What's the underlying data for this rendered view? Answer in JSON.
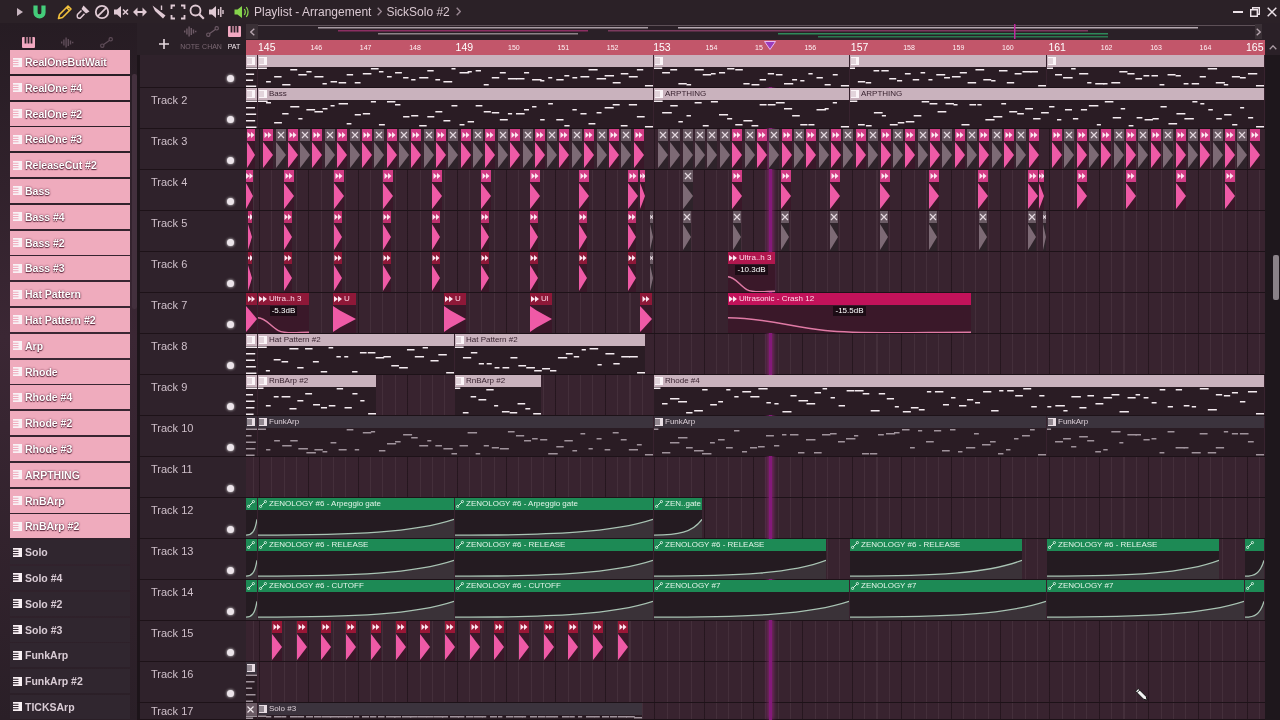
{
  "toolbar": {
    "snap": {
      "on": true
    },
    "tools": [
      {
        "kind": "draw",
        "selected": true
      },
      {
        "kind": "paint",
        "selected": false
      },
      {
        "kind": "delete",
        "selected": false
      },
      {
        "kind": "mute",
        "selected": false
      },
      {
        "kind": "slip",
        "selected": false
      },
      {
        "kind": "slice",
        "selected": false
      },
      {
        "kind": "select",
        "selected": false
      },
      {
        "kind": "zoom",
        "selected": false
      },
      {
        "kind": "playback",
        "selected": false
      }
    ],
    "breadcrumb": [
      "Playlist - Arrangement",
      "SickSolo #2"
    ]
  },
  "picker": {
    "tabs": [
      {
        "kind": "patterns",
        "selected": true
      },
      {
        "kind": "audio",
        "selected": false
      },
      {
        "kind": "automation",
        "selected": false
      }
    ],
    "items": [
      {
        "label": "RealOneButWait",
        "color": "#efabbd"
      },
      {
        "label": "RealOne #4",
        "color": "#efabbd"
      },
      {
        "label": "RealOne #2",
        "color": "#efabbd"
      },
      {
        "label": "RealOne #3",
        "color": "#efabbd"
      },
      {
        "label": "ReleaseCut #2",
        "color": "#efabbd"
      },
      {
        "label": "Bass",
        "color": "#efabbd"
      },
      {
        "label": "Bass #4",
        "color": "#efabbd"
      },
      {
        "label": "Bass #2",
        "color": "#efabbd"
      },
      {
        "label": "Bass #3",
        "color": "#efabbd"
      },
      {
        "label": "Hat Pattern",
        "color": "#efabbd"
      },
      {
        "label": "Hat Pattern #2",
        "color": "#efabbd"
      },
      {
        "label": "Arp",
        "color": "#efabbd"
      },
      {
        "label": "Rhode",
        "color": "#efabbd"
      },
      {
        "label": "Rhode #4",
        "color": "#efabbd"
      },
      {
        "label": "Rhode #2",
        "color": "#efabbd"
      },
      {
        "label": "Rhode #3",
        "color": "#efabbd"
      },
      {
        "label": "ARPTHING",
        "color": "#efabbd"
      },
      {
        "label": "RnBArp",
        "color": "#efabbd"
      },
      {
        "label": "RnBArp #2",
        "color": "#efabbd"
      },
      {
        "label": "Solo",
        "color": "#30262f"
      },
      {
        "label": "Solo #4",
        "color": "#30262f"
      },
      {
        "label": "Solo #2",
        "color": "#30262f"
      },
      {
        "label": "Solo #3",
        "color": "#30262f"
      },
      {
        "label": "FunkArp",
        "color": "#30262f"
      },
      {
        "label": "FunkArp #2",
        "color": "#30262f"
      },
      {
        "label": "TICKSArp",
        "color": "#30262f"
      }
    ]
  },
  "modes": [
    {
      "label": "NOTE",
      "kind": "note",
      "selected": false
    },
    {
      "label": "CHAN",
      "kind": "channel",
      "selected": false
    },
    {
      "label": "PAT",
      "kind": "pattern",
      "selected": true
    }
  ],
  "ruler": [
    {
      "label": "145",
      "major": true
    },
    {
      "label": "146",
      "major": false
    },
    {
      "label": "147",
      "major": false
    },
    {
      "label": "148",
      "major": false
    },
    {
      "label": "149",
      "major": true
    },
    {
      "label": "150",
      "major": false
    },
    {
      "label": "151",
      "major": false
    },
    {
      "label": "152",
      "major": false
    },
    {
      "label": "153",
      "major": true
    },
    {
      "label": "154",
      "major": false
    },
    {
      "label": "15",
      "major": false
    },
    {
      "label": "156",
      "major": false
    },
    {
      "label": "157",
      "major": true
    },
    {
      "label": "158",
      "major": false
    },
    {
      "label": "159",
      "major": false
    },
    {
      "label": "160",
      "major": false
    },
    {
      "label": "161",
      "major": true
    },
    {
      "label": "162",
      "major": false
    },
    {
      "label": "163",
      "major": false
    },
    {
      "label": "164",
      "major": false
    },
    {
      "label": "165",
      "major": true
    }
  ],
  "tracks": [
    {
      "enabled": true,
      "color": "#c9b2bd",
      "clips": [
        {
          "kind": "pattern"
        },
        {
          "kind": "pattern"
        },
        {
          "kind": "pattern"
        },
        {
          "kind": "pattern"
        },
        {
          "kind": "pattern"
        }
      ]
    },
    {
      "label": "Track 2",
      "enabled": true,
      "color": "#c9b2bd",
      "clips": [
        {
          "kind": "pattern"
        },
        {
          "kind": "pattern",
          "label": "Bass"
        },
        {
          "kind": "pattern",
          "label": "ARPTHING"
        },
        {
          "kind": "pattern",
          "label": "ARPTHING"
        }
      ]
    },
    {
      "label": "Track 3",
      "enabled": true,
      "color": "#d23c86",
      "clips": [
        {
          "kind": "audio",
          "muted": false
        },
        {
          "kind": "audio",
          "muted": false
        },
        {
          "kind": "audio",
          "muted": true
        },
        {
          "kind": "audio",
          "muted": false
        },
        {
          "kind": "audio",
          "muted": true
        },
        {
          "kind": "audio",
          "muted": false
        },
        {
          "kind": "audio",
          "muted": true
        },
        {
          "kind": "audio",
          "muted": false
        },
        {
          "kind": "audio",
          "muted": true
        },
        {
          "kind": "audio",
          "muted": false
        },
        {
          "kind": "audio",
          "muted": true
        },
        {
          "kind": "audio",
          "muted": false
        },
        {
          "kind": "audio",
          "muted": true
        },
        {
          "kind": "audio",
          "muted": false
        },
        {
          "kind": "audio",
          "muted": true
        },
        {
          "kind": "audio",
          "muted": false
        },
        {
          "kind": "audio",
          "muted": true
        },
        {
          "kind": "audio",
          "muted": false
        },
        {
          "kind": "audio",
          "muted": true
        },
        {
          "kind": "audio",
          "muted": false
        },
        {
          "kind": "audio",
          "muted": true
        },
        {
          "kind": "audio",
          "muted": false
        },
        {
          "kind": "audio",
          "muted": true
        },
        {
          "kind": "audio",
          "muted": false
        },
        {
          "kind": "audio",
          "muted": true
        },
        {
          "kind": "audio",
          "muted": false
        },
        {
          "kind": "audio",
          "muted": true
        },
        {
          "kind": "audio",
          "muted": false
        },
        {
          "kind": "audio",
          "muted": true
        },
        {
          "kind": "audio",
          "muted": false
        },
        {
          "kind": "audio",
          "muted": true
        },
        {
          "kind": "audio",
          "muted": false
        },
        {
          "kind": "audio",
          "muted": true
        },
        {
          "kind": "audio",
          "muted": true
        },
        {
          "kind": "audio",
          "muted": true
        },
        {
          "kind": "audio",
          "muted": true
        },
        {
          "kind": "audio",
          "muted": true
        },
        {
          "kind": "audio",
          "muted": true
        },
        {
          "kind": "audio",
          "muted": false
        },
        {
          "kind": "audio",
          "muted": true
        },
        {
          "kind": "audio",
          "muted": false
        },
        {
          "kind": "audio",
          "muted": true
        },
        {
          "kind": "audio",
          "muted": false
        },
        {
          "kind": "audio",
          "muted": true
        },
        {
          "kind": "audio",
          "muted": false
        },
        {
          "kind": "audio",
          "muted": true
        },
        {
          "kind": "audio",
          "muted": false
        },
        {
          "kind": "audio",
          "muted": true
        },
        {
          "kind": "audio",
          "muted": false
        },
        {
          "kind": "audio",
          "muted": true
        },
        {
          "kind": "audio",
          "muted": false
        },
        {
          "kind": "audio",
          "muted": true
        },
        {
          "kind": "audio",
          "muted": false
        },
        {
          "kind": "audio",
          "muted": true
        },
        {
          "kind": "audio",
          "muted": false
        },
        {
          "kind": "audio",
          "muted": true
        },
        {
          "kind": "audio",
          "muted": false
        },
        {
          "kind": "audio",
          "muted": true
        },
        {
          "kind": "audio",
          "muted": false
        },
        {
          "kind": "audio",
          "muted": true
        },
        {
          "kind": "audio",
          "muted": false
        },
        {
          "kind": "audio",
          "muted": true
        },
        {
          "kind": "audio",
          "muted": false
        },
        {
          "kind": "audio",
          "muted": false
        },
        {
          "kind": "audio",
          "muted": true
        },
        {
          "kind": "audio",
          "muted": false
        },
        {
          "kind": "audio",
          "muted": true
        },
        {
          "kind": "audio",
          "muted": false
        },
        {
          "kind": "audio",
          "muted": true
        },
        {
          "kind": "audio",
          "muted": false
        },
        {
          "kind": "audio",
          "muted": true
        },
        {
          "kind": "audio",
          "muted": false
        },
        {
          "kind": "audio",
          "muted": true
        },
        {
          "kind": "audio",
          "muted": false
        },
        {
          "kind": "audio",
          "muted": true
        },
        {
          "kind": "audio",
          "muted": false
        },
        {
          "kind": "audio",
          "muted": true
        },
        {
          "kind": "audio",
          "muted": false
        },
        {
          "kind": "audio",
          "muted": true
        },
        {
          "kind": "audio",
          "muted": false
        }
      ]
    },
    {
      "label": "Track 4",
      "enabled": true,
      "color": "#d23c86",
      "clips": [
        {
          "kind": "audio",
          "muted": false
        },
        {
          "kind": "audio",
          "muted": false
        },
        {
          "kind": "audio",
          "muted": false
        },
        {
          "kind": "audio",
          "muted": false
        },
        {
          "kind": "audio",
          "muted": false
        },
        {
          "kind": "audio",
          "muted": false
        },
        {
          "kind": "audio",
          "muted": false
        },
        {
          "kind": "audio",
          "muted": false
        },
        {
          "kind": "audio",
          "muted": false
        },
        {
          "kind": "audio",
          "muted": false
        },
        {
          "kind": "audio",
          "muted": true
        },
        {
          "kind": "audio",
          "muted": false
        },
        {
          "kind": "audio",
          "muted": false
        },
        {
          "kind": "audio",
          "muted": false
        },
        {
          "kind": "audio",
          "muted": false
        },
        {
          "kind": "audio",
          "muted": false
        },
        {
          "kind": "audio",
          "muted": false
        },
        {
          "kind": "audio",
          "muted": false
        },
        {
          "kind": "audio",
          "muted": false
        },
        {
          "kind": "audio",
          "muted": false
        },
        {
          "kind": "audio",
          "muted": false
        },
        {
          "kind": "audio",
          "muted": false
        },
        {
          "kind": "audio",
          "muted": false
        }
      ]
    },
    {
      "label": "Track 5",
      "enabled": true,
      "color": "#c0306e",
      "clips": [
        {
          "kind": "audio",
          "muted": false
        },
        {
          "kind": "audio",
          "muted": false
        },
        {
          "kind": "audio",
          "muted": false
        },
        {
          "kind": "audio",
          "muted": false
        },
        {
          "kind": "audio",
          "muted": false
        },
        {
          "kind": "audio",
          "muted": false
        },
        {
          "kind": "audio",
          "muted": false
        },
        {
          "kind": "audio",
          "muted": false
        },
        {
          "kind": "audio",
          "muted": false
        },
        {
          "kind": "audio",
          "muted": true
        },
        {
          "kind": "audio",
          "muted": true
        },
        {
          "kind": "audio",
          "muted": true
        },
        {
          "kind": "audio",
          "muted": true
        },
        {
          "kind": "audio",
          "muted": true
        },
        {
          "kind": "audio",
          "muted": true
        },
        {
          "kind": "audio",
          "muted": true
        },
        {
          "kind": "audio",
          "muted": true
        },
        {
          "kind": "audio",
          "muted": true
        },
        {
          "kind": "audio",
          "muted": true
        }
      ]
    },
    {
      "label": "Track 6",
      "enabled": true,
      "color": "#8e1838",
      "clips": [
        {
          "kind": "audio",
          "muted": false
        },
        {
          "kind": "audio",
          "muted": false
        },
        {
          "kind": "audio",
          "muted": false
        },
        {
          "kind": "audio",
          "muted": false
        },
        {
          "kind": "audio",
          "muted": false
        },
        {
          "kind": "audio",
          "muted": false
        },
        {
          "kind": "audio",
          "muted": false
        },
        {
          "kind": "audio",
          "muted": false
        },
        {
          "kind": "audio",
          "muted": false
        },
        {
          "kind": "audio",
          "muted": true
        },
        {
          "kind": "audio",
          "label": "Ultra..h 3",
          "gain": "-10.3dB",
          "color": "#b0174e",
          "muted": false
        }
      ]
    },
    {
      "label": "Track 7",
      "enabled": true,
      "color": "#8e1838",
      "clips": [
        {
          "kind": "audio",
          "muted": false
        },
        {
          "kind": "audio",
          "label": "Ultra..h 3",
          "gain": "-5.3dB",
          "muted": false
        },
        {
          "kind": "audio",
          "label": "U",
          "muted": false
        },
        {
          "kind": "audio",
          "label": "U",
          "muted": false
        },
        {
          "kind": "audio",
          "label": "Ul",
          "muted": false
        },
        {
          "kind": "audio",
          "muted": false
        },
        {
          "kind": "audio",
          "label": "Ultrasonic - Crash 12",
          "gain": "-15.5dB",
          "color": "#c2125a",
          "muted": false
        }
      ]
    },
    {
      "label": "Track 8",
      "enabled": true,
      "color": "#c9b2bd",
      "clips": [
        {
          "kind": "pattern"
        },
        {
          "kind": "pattern",
          "label": "Hat Pattern #2"
        },
        {
          "kind": "pattern",
          "label": "Hat Pattern #2"
        }
      ]
    },
    {
      "label": "Track 9",
      "enabled": true,
      "color": "#c9b2bd",
      "clips": [
        {
          "kind": "pattern"
        },
        {
          "kind": "pattern",
          "label": "RnBArp #2"
        },
        {
          "kind": "pattern",
          "label": "RnBArp #2"
        },
        {
          "kind": "pattern",
          "label": "Rhode #4"
        }
      ]
    },
    {
      "label": "Track 10",
      "enabled": true,
      "color": "#3b333d",
      "clips": [
        {
          "kind": "pattern"
        },
        {
          "kind": "pattern",
          "label": "FunkArp"
        },
        {
          "kind": "pattern",
          "label": "FunkArp"
        },
        {
          "kind": "pattern",
          "label": "FunkArp"
        }
      ]
    },
    {
      "label": "Track 11",
      "enabled": true
    },
    {
      "label": "Track 12",
      "enabled": true,
      "color": "#1d8a55",
      "clips": [
        {
          "kind": "automation"
        },
        {
          "kind": "automation",
          "label": "ZENOLOGY #6 - Arpeggio gate"
        },
        {
          "kind": "automation",
          "label": "ZENOLOGY #6 - Arpeggio gate"
        },
        {
          "kind": "automation",
          "label": "ZEN..gate"
        }
      ]
    },
    {
      "label": "Track 13",
      "enabled": true,
      "color": "#1d8a55",
      "clips": [
        {
          "kind": "automation"
        },
        {
          "kind": "automation",
          "label": "ZENOLOGY #6 - RELEASE"
        },
        {
          "kind": "automation",
          "label": "ZENOLOGY #6 - RELEASE"
        },
        {
          "kind": "automation",
          "label": "ZENOLOGY #6 - RELEASE"
        },
        {
          "kind": "automation",
          "label": "ZENOLOGY #6 - RELEASE"
        },
        {
          "kind": "automation",
          "label": "ZENOLOGY #6 - RELEASE"
        },
        {
          "kind": "automation"
        }
      ]
    },
    {
      "label": "Track 14",
      "enabled": true,
      "color": "#1d8a55",
      "clips": [
        {
          "kind": "automation"
        },
        {
          "kind": "automation",
          "label": "ZENOLOGY #6 - CUTOFF"
        },
        {
          "kind": "automation",
          "label": "ZENOLOGY #6 - CUTOFF"
        },
        {
          "kind": "automation",
          "label": "ZENOLOGY #7"
        },
        {
          "kind": "automation",
          "label": "ZENOLOGY #7"
        },
        {
          "kind": "automation",
          "label": "ZENOLOGY #7"
        },
        {
          "kind": "automation"
        }
      ]
    },
    {
      "label": "Track 15",
      "enabled": true,
      "color": "#9a1636",
      "clips": [
        {
          "kind": "audio",
          "muted": false
        },
        {
          "kind": "audio",
          "muted": false
        },
        {
          "kind": "audio",
          "muted": false
        },
        {
          "kind": "audio",
          "muted": false
        },
        {
          "kind": "audio",
          "muted": false
        },
        {
          "kind": "audio",
          "muted": false
        },
        {
          "kind": "audio",
          "muted": false
        },
        {
          "kind": "audio",
          "muted": false
        },
        {
          "kind": "audio",
          "muted": false
        },
        {
          "kind": "audio",
          "muted": false
        },
        {
          "kind": "audio",
          "muted": false
        },
        {
          "kind": "audio",
          "muted": false
        },
        {
          "kind": "audio",
          "muted": false
        },
        {
          "kind": "audio",
          "muted": false
        },
        {
          "kind": "audio",
          "muted": false
        }
      ]
    },
    {
      "label": "Track 16",
      "enabled": true,
      "color": "#3b333d",
      "clips": [
        {
          "kind": "pattern"
        }
      ]
    },
    {
      "label": "Track 17",
      "color": "#3b333d",
      "clips": [
        {
          "kind": "pattern",
          "muted": true
        },
        {
          "kind": "pattern",
          "label": "Solo #3",
          "muted": false
        }
      ]
    }
  ]
}
